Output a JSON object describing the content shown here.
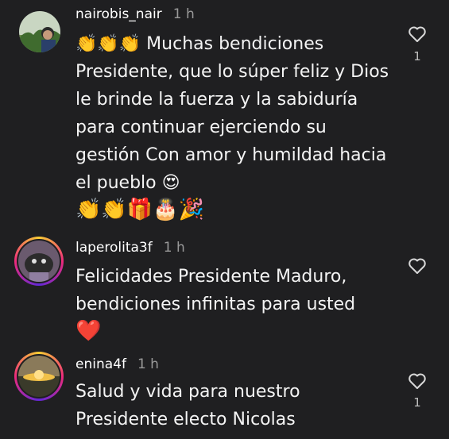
{
  "comments": [
    {
      "username": "nairobis_nair",
      "time": "1 h",
      "text": "👏👏👏 Muchas bendiciones Presidente, que lo súper feliz y Dios le brinde la fuerza y la sabiduría para continuar ejerciendo su gestión Con amor y humildad hacia el pueblo 😍",
      "emoji_line": "👏👏🎁🎂🎉",
      "likes": "1"
    },
    {
      "username": "laperolita3f",
      "time": "1 h",
      "text": "Felicidades Presidente Maduro, bendiciones infinitas para usted",
      "emoji_line": "❤️"
    },
    {
      "username": "enina4f",
      "time": "1 h",
      "text": "Salud y vida para nuestro Presidente electo Nicolas",
      "likes": "1"
    }
  ],
  "colors": {
    "background": "#1f1f21",
    "story_ring": "#ee2a7b"
  },
  "icons": {
    "like": "heart-outline-icon"
  }
}
